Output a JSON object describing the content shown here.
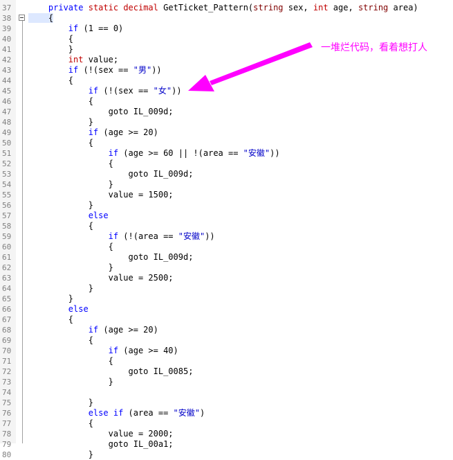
{
  "editor": {
    "lines": [
      {
        "n": "37",
        "segs": [
          {
            "t": "    ",
            "c": ""
          },
          {
            "t": "private",
            "c": "kw"
          },
          {
            "t": " ",
            "c": ""
          },
          {
            "t": "static",
            "c": "tk"
          },
          {
            "t": " ",
            "c": ""
          },
          {
            "t": "decimal",
            "c": "tk"
          },
          {
            "t": " GetTicket_Pattern(",
            "c": ""
          },
          {
            "t": "string",
            "c": "ty"
          },
          {
            "t": " sex, ",
            "c": ""
          },
          {
            "t": "int",
            "c": "tk"
          },
          {
            "t": " age, ",
            "c": ""
          },
          {
            "t": "string",
            "c": "ty"
          },
          {
            "t": " area)",
            "c": ""
          }
        ]
      },
      {
        "n": "38",
        "segs": [
          {
            "t": "    {",
            "c": "cur"
          }
        ]
      },
      {
        "n": "39",
        "segs": [
          {
            "t": "        ",
            "c": ""
          },
          {
            "t": "if",
            "c": "kw"
          },
          {
            "t": " (1 == 0)",
            "c": ""
          }
        ]
      },
      {
        "n": "40",
        "segs": [
          {
            "t": "        {",
            "c": ""
          }
        ]
      },
      {
        "n": "41",
        "segs": [
          {
            "t": "        }",
            "c": ""
          }
        ]
      },
      {
        "n": "42",
        "segs": [
          {
            "t": "        ",
            "c": ""
          },
          {
            "t": "int",
            "c": "tk"
          },
          {
            "t": " value;",
            "c": ""
          }
        ]
      },
      {
        "n": "43",
        "segs": [
          {
            "t": "        ",
            "c": ""
          },
          {
            "t": "if",
            "c": "kw"
          },
          {
            "t": " (!(sex == ",
            "c": ""
          },
          {
            "t": "\"男\"",
            "c": "st"
          },
          {
            "t": "))",
            "c": ""
          }
        ]
      },
      {
        "n": "44",
        "segs": [
          {
            "t": "        {",
            "c": ""
          }
        ]
      },
      {
        "n": "45",
        "segs": [
          {
            "t": "            ",
            "c": ""
          },
          {
            "t": "if",
            "c": "kw"
          },
          {
            "t": " (!(sex == ",
            "c": ""
          },
          {
            "t": "\"女\"",
            "c": "st"
          },
          {
            "t": "))",
            "c": ""
          }
        ]
      },
      {
        "n": "46",
        "segs": [
          {
            "t": "            {",
            "c": ""
          }
        ]
      },
      {
        "n": "47",
        "segs": [
          {
            "t": "                goto IL_009d;",
            "c": ""
          }
        ]
      },
      {
        "n": "48",
        "segs": [
          {
            "t": "            }",
            "c": ""
          }
        ]
      },
      {
        "n": "49",
        "segs": [
          {
            "t": "            ",
            "c": ""
          },
          {
            "t": "if",
            "c": "kw"
          },
          {
            "t": " (age >= 20)",
            "c": ""
          }
        ]
      },
      {
        "n": "50",
        "segs": [
          {
            "t": "            {",
            "c": ""
          }
        ]
      },
      {
        "n": "51",
        "segs": [
          {
            "t": "                ",
            "c": ""
          },
          {
            "t": "if",
            "c": "kw"
          },
          {
            "t": " (age >= 60 || !(area == ",
            "c": ""
          },
          {
            "t": "\"安徽\"",
            "c": "st"
          },
          {
            "t": "))",
            "c": ""
          }
        ]
      },
      {
        "n": "52",
        "segs": [
          {
            "t": "                {",
            "c": ""
          }
        ]
      },
      {
        "n": "53",
        "segs": [
          {
            "t": "                    goto IL_009d;",
            "c": ""
          }
        ]
      },
      {
        "n": "54",
        "segs": [
          {
            "t": "                }",
            "c": ""
          }
        ]
      },
      {
        "n": "55",
        "segs": [
          {
            "t": "                value = 1500;",
            "c": ""
          }
        ]
      },
      {
        "n": "56",
        "segs": [
          {
            "t": "            }",
            "c": ""
          }
        ]
      },
      {
        "n": "57",
        "segs": [
          {
            "t": "            ",
            "c": ""
          },
          {
            "t": "else",
            "c": "kw"
          }
        ]
      },
      {
        "n": "58",
        "segs": [
          {
            "t": "            {",
            "c": ""
          }
        ]
      },
      {
        "n": "59",
        "segs": [
          {
            "t": "                ",
            "c": ""
          },
          {
            "t": "if",
            "c": "kw"
          },
          {
            "t": " (!(area == ",
            "c": ""
          },
          {
            "t": "\"安徽\"",
            "c": "st"
          },
          {
            "t": "))",
            "c": ""
          }
        ]
      },
      {
        "n": "60",
        "segs": [
          {
            "t": "                {",
            "c": ""
          }
        ]
      },
      {
        "n": "61",
        "segs": [
          {
            "t": "                    goto IL_009d;",
            "c": ""
          }
        ]
      },
      {
        "n": "62",
        "segs": [
          {
            "t": "                }",
            "c": ""
          }
        ]
      },
      {
        "n": "63",
        "segs": [
          {
            "t": "                value = 2500;",
            "c": ""
          }
        ]
      },
      {
        "n": "64",
        "segs": [
          {
            "t": "            }",
            "c": ""
          }
        ]
      },
      {
        "n": "65",
        "segs": [
          {
            "t": "        }",
            "c": ""
          }
        ]
      },
      {
        "n": "66",
        "segs": [
          {
            "t": "        ",
            "c": ""
          },
          {
            "t": "else",
            "c": "kw"
          }
        ]
      },
      {
        "n": "67",
        "segs": [
          {
            "t": "        {",
            "c": ""
          }
        ]
      },
      {
        "n": "68",
        "segs": [
          {
            "t": "            ",
            "c": ""
          },
          {
            "t": "if",
            "c": "kw"
          },
          {
            "t": " (age >= 20)",
            "c": ""
          }
        ]
      },
      {
        "n": "69",
        "segs": [
          {
            "t": "            {",
            "c": ""
          }
        ]
      },
      {
        "n": "70",
        "segs": [
          {
            "t": "                ",
            "c": ""
          },
          {
            "t": "if",
            "c": "kw"
          },
          {
            "t": " (age >= 40)",
            "c": ""
          }
        ]
      },
      {
        "n": "71",
        "segs": [
          {
            "t": "                {",
            "c": ""
          }
        ]
      },
      {
        "n": "72",
        "segs": [
          {
            "t": "                    goto IL_0085;",
            "c": ""
          }
        ]
      },
      {
        "n": "73",
        "segs": [
          {
            "t": "                }",
            "c": ""
          }
        ]
      },
      {
        "n": "74",
        "segs": [
          {
            "t": "",
            "c": ""
          }
        ]
      },
      {
        "n": "75",
        "segs": [
          {
            "t": "            }",
            "c": ""
          }
        ]
      },
      {
        "n": "76",
        "segs": [
          {
            "t": "            ",
            "c": ""
          },
          {
            "t": "else",
            "c": "kw"
          },
          {
            "t": " ",
            "c": ""
          },
          {
            "t": "if",
            "c": "kw"
          },
          {
            "t": " (area == ",
            "c": ""
          },
          {
            "t": "\"安徽\"",
            "c": "st"
          },
          {
            "t": ")",
            "c": ""
          }
        ]
      },
      {
        "n": "77",
        "segs": [
          {
            "t": "            {",
            "c": ""
          }
        ]
      },
      {
        "n": "78",
        "segs": [
          {
            "t": "                value = 2000;",
            "c": ""
          }
        ]
      },
      {
        "n": "79",
        "segs": [
          {
            "t": "                goto IL_00a1;",
            "c": ""
          }
        ]
      },
      {
        "n": "80",
        "segs": [
          {
            "t": "            }",
            "c": ""
          }
        ]
      }
    ]
  },
  "annotation": {
    "text": "一堆烂代码，看着想打人",
    "color": "#ff00ff"
  }
}
